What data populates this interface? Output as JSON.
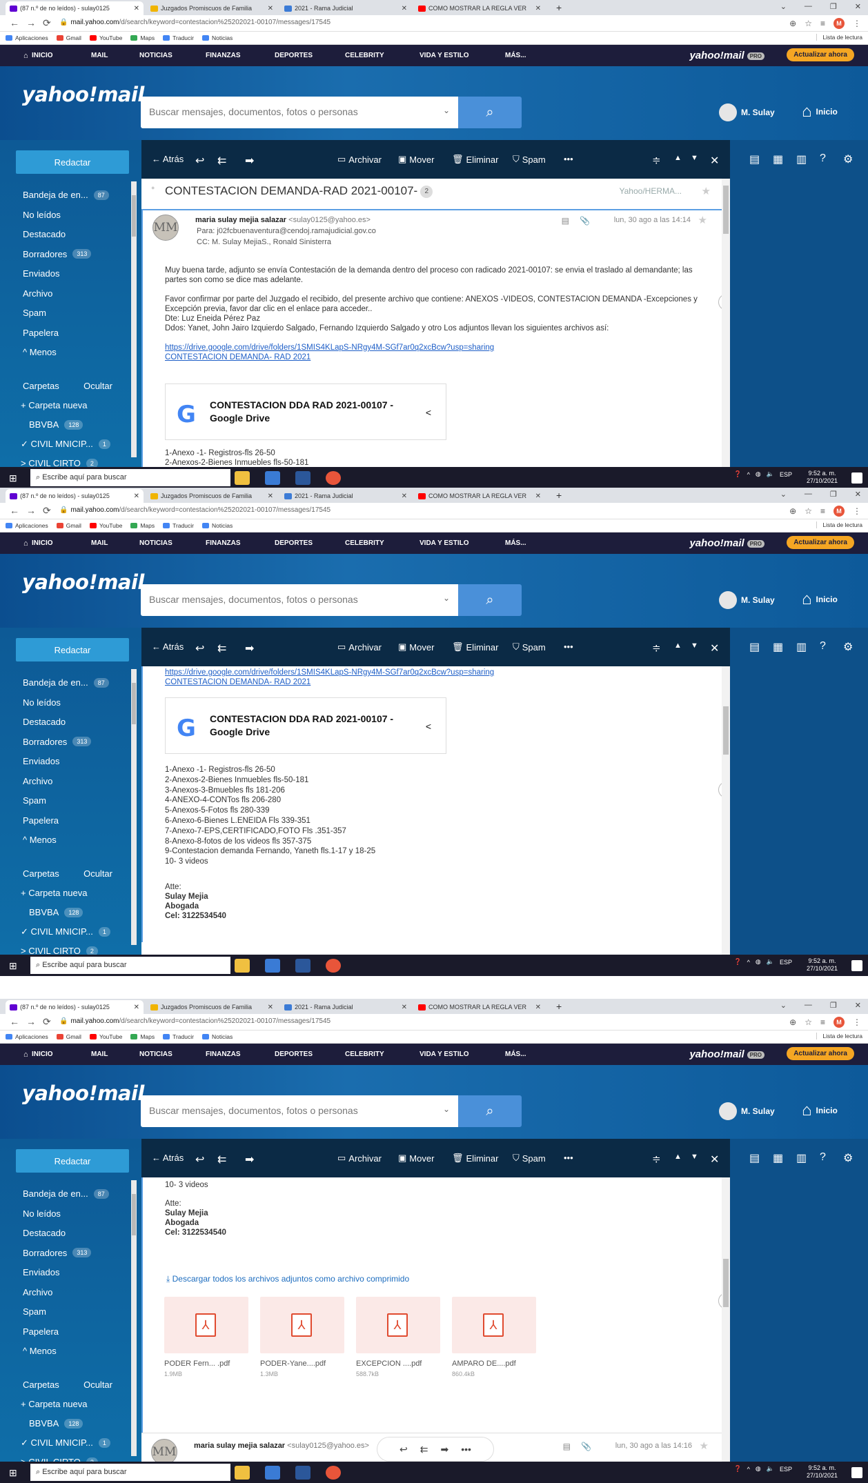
{
  "browser": {
    "tabs": [
      {
        "label": "(87 n.º de no leídos) - sulay0125",
        "fav_color": "#6001d2"
      },
      {
        "label": "Juzgados Promiscuos de Familia",
        "fav_color": "#f0b400"
      },
      {
        "label": "2021 - Rama Judicial",
        "fav_color": "#3b7bd6"
      },
      {
        "label": "COMO MOSTRAR LA REGLA VER",
        "fav_color": "#ff0000"
      }
    ],
    "new_tab": "+",
    "url_domain": "mail.yahoo.com",
    "url_path": "/d/search/keyword=contestacion%25202021-00107/messages/17545",
    "profile_initial": "M",
    "bookmarks": [
      {
        "label": "Aplicaciones",
        "color": "#4285f4"
      },
      {
        "label": "Gmail",
        "color": "#ea4335"
      },
      {
        "label": "YouTube",
        "color": "#ff0000"
      },
      {
        "label": "Maps",
        "color": "#34a853"
      },
      {
        "label": "Traducir",
        "color": "#4285f4"
      },
      {
        "label": "Noticias",
        "color": "#4285f4"
      }
    ],
    "reading_list": "Lista de lectura"
  },
  "yahoo": {
    "nav": [
      "INICIO",
      "MAIL",
      "NOTICIAS",
      "FINANZAS",
      "DEPORTES",
      "CELEBRITY",
      "VIDA Y ESTILO",
      "MÁS..."
    ],
    "logo_small": "yahoo!mail",
    "pro": "PRO",
    "upgrade": "Actualizar ahora",
    "logo": "yahoo!mail",
    "search_placeholder": "Buscar mensajes, documentos, fotos o personas",
    "user": "M. Sulay",
    "home": "Inicio"
  },
  "sidebar": {
    "compose": "Redactar",
    "items": [
      {
        "label": "Bandeja de en...",
        "badge": "87"
      },
      {
        "label": "No leídos",
        "badge": ""
      },
      {
        "label": "Destacado",
        "badge": ""
      },
      {
        "label": "Borradores",
        "badge": "313"
      },
      {
        "label": "Enviados",
        "badge": ""
      },
      {
        "label": "Archivo",
        "badge": ""
      },
      {
        "label": "Spam",
        "badge": ""
      },
      {
        "label": "Papelera",
        "badge": ""
      },
      {
        "label": "^ Menos",
        "badge": ""
      }
    ],
    "folders_label": "Carpetas",
    "hide_label": "Ocultar",
    "new_folder": "+ Carpeta nueva",
    "folders": [
      {
        "label": "BBVBA",
        "badge": "128"
      },
      {
        "label": "✓ CIVIL MNICIP...",
        "badge": "1"
      },
      {
        "label": "> CIVIL CIRTO",
        "badge": "2"
      }
    ]
  },
  "toolbar": {
    "back": "← Atrás",
    "archive": "Archivar",
    "move": "Mover",
    "delete": "Eliminar",
    "spam": "Spam",
    "more": "•••"
  },
  "email": {
    "subject": "CONTESTACION DEMANDA-RAD 2021-00107-",
    "thread_count": "2",
    "folder": "Yahoo/HERMA...",
    "avatar": "MM",
    "sender_name": "maria sulay mejia salazar",
    "sender_email": "<sulay0125@yahoo.es>",
    "to": "Para: j02fcbuenaventura@cendoj.ramajudicial.gov.co",
    "cc": "CC: M. Sulay MejiaS.,  Ronald Sinisterra",
    "date": "lun, 30 ago a las 14:14",
    "para1": "Muy buena tarde, adjunto se envía Contestación de la demanda dentro del proceso con radicado 2021-00107: se envia el traslado al demandante; las partes son como se dice mas adelante.",
    "para2a": "Favor confirmar por parte del Juzgado el recibido,  del presente archivo que contiene: ANEXOS -VIDEOS, CONTESTACION DEMANDA -Excepciones y Excepción previa, favor dar clic en el enlace para acceder..",
    "para2b": "Dte: Luz Eneida Pérez Paz",
    "para2c": "Ddos: Yanet, John Jairo Izquierdo Salgado, Fernando Izquierdo Salgado y otro Los adjuntos llevan los siguientes archivos así:",
    "link": "https://drive.google.com/drive/folders/1SMIS4KLapS-NRgy4M-SGf7ar0q2xcBcw?usp=sharing",
    "link_title": "CONTESTACION DEMANDA- RAD 2021",
    "drive_card_title": "CONTESTACION DDA RAD 2021-00107 -",
    "drive_card_sub": "Google Drive",
    "drive_g": "G",
    "list": [
      "1-Anexo -1- Registros-fls 26-50",
      "2-Anexos-2-Bienes Inmuebles fls-50-181",
      "3-Anexos-3-Bmuebles fls 181-206",
      "4-ANEXO-4-CONTos fls 206-280",
      "5-Anexos-5-Fotos fls 280-339",
      "6-Anexo-6-Bienes L.ENEIDA Fls 339-351",
      "7-Anexo-7-EPS,CERTIFICADO,FOTO Fls .351-357",
      "8-Anexo-8-fotos de los videos fls 357-375",
      "9-Contestacion demanda Fernando, Yaneth fls.1-17 y 18-25",
      "10- 3 videos"
    ],
    "sign_atte": "Atte:",
    "sign_name": "Sulay Mejia",
    "sign_role": "Abogada",
    "sign_cel": "Cel: 3122534540",
    "download_all": "Descargar todos los archivos adjuntos como archivo comprimido",
    "attachments": [
      {
        "name": "PODER Fern... .pdf",
        "size": "1.9MB"
      },
      {
        "name": "PODER-Yane....pdf",
        "size": "1.3MB"
      },
      {
        "name": "EXCEPCION ....pdf",
        "size": "588.7kB"
      },
      {
        "name": "AMPARO DE....pdf",
        "size": "860.4kB"
      }
    ],
    "reply2_date": "lun, 30 ago a las 14:16"
  },
  "taskbar": {
    "search": "Escribe aquí para buscar",
    "lang": "ESP",
    "time": "9:52 a. m.",
    "date": "27/10/2021"
  }
}
